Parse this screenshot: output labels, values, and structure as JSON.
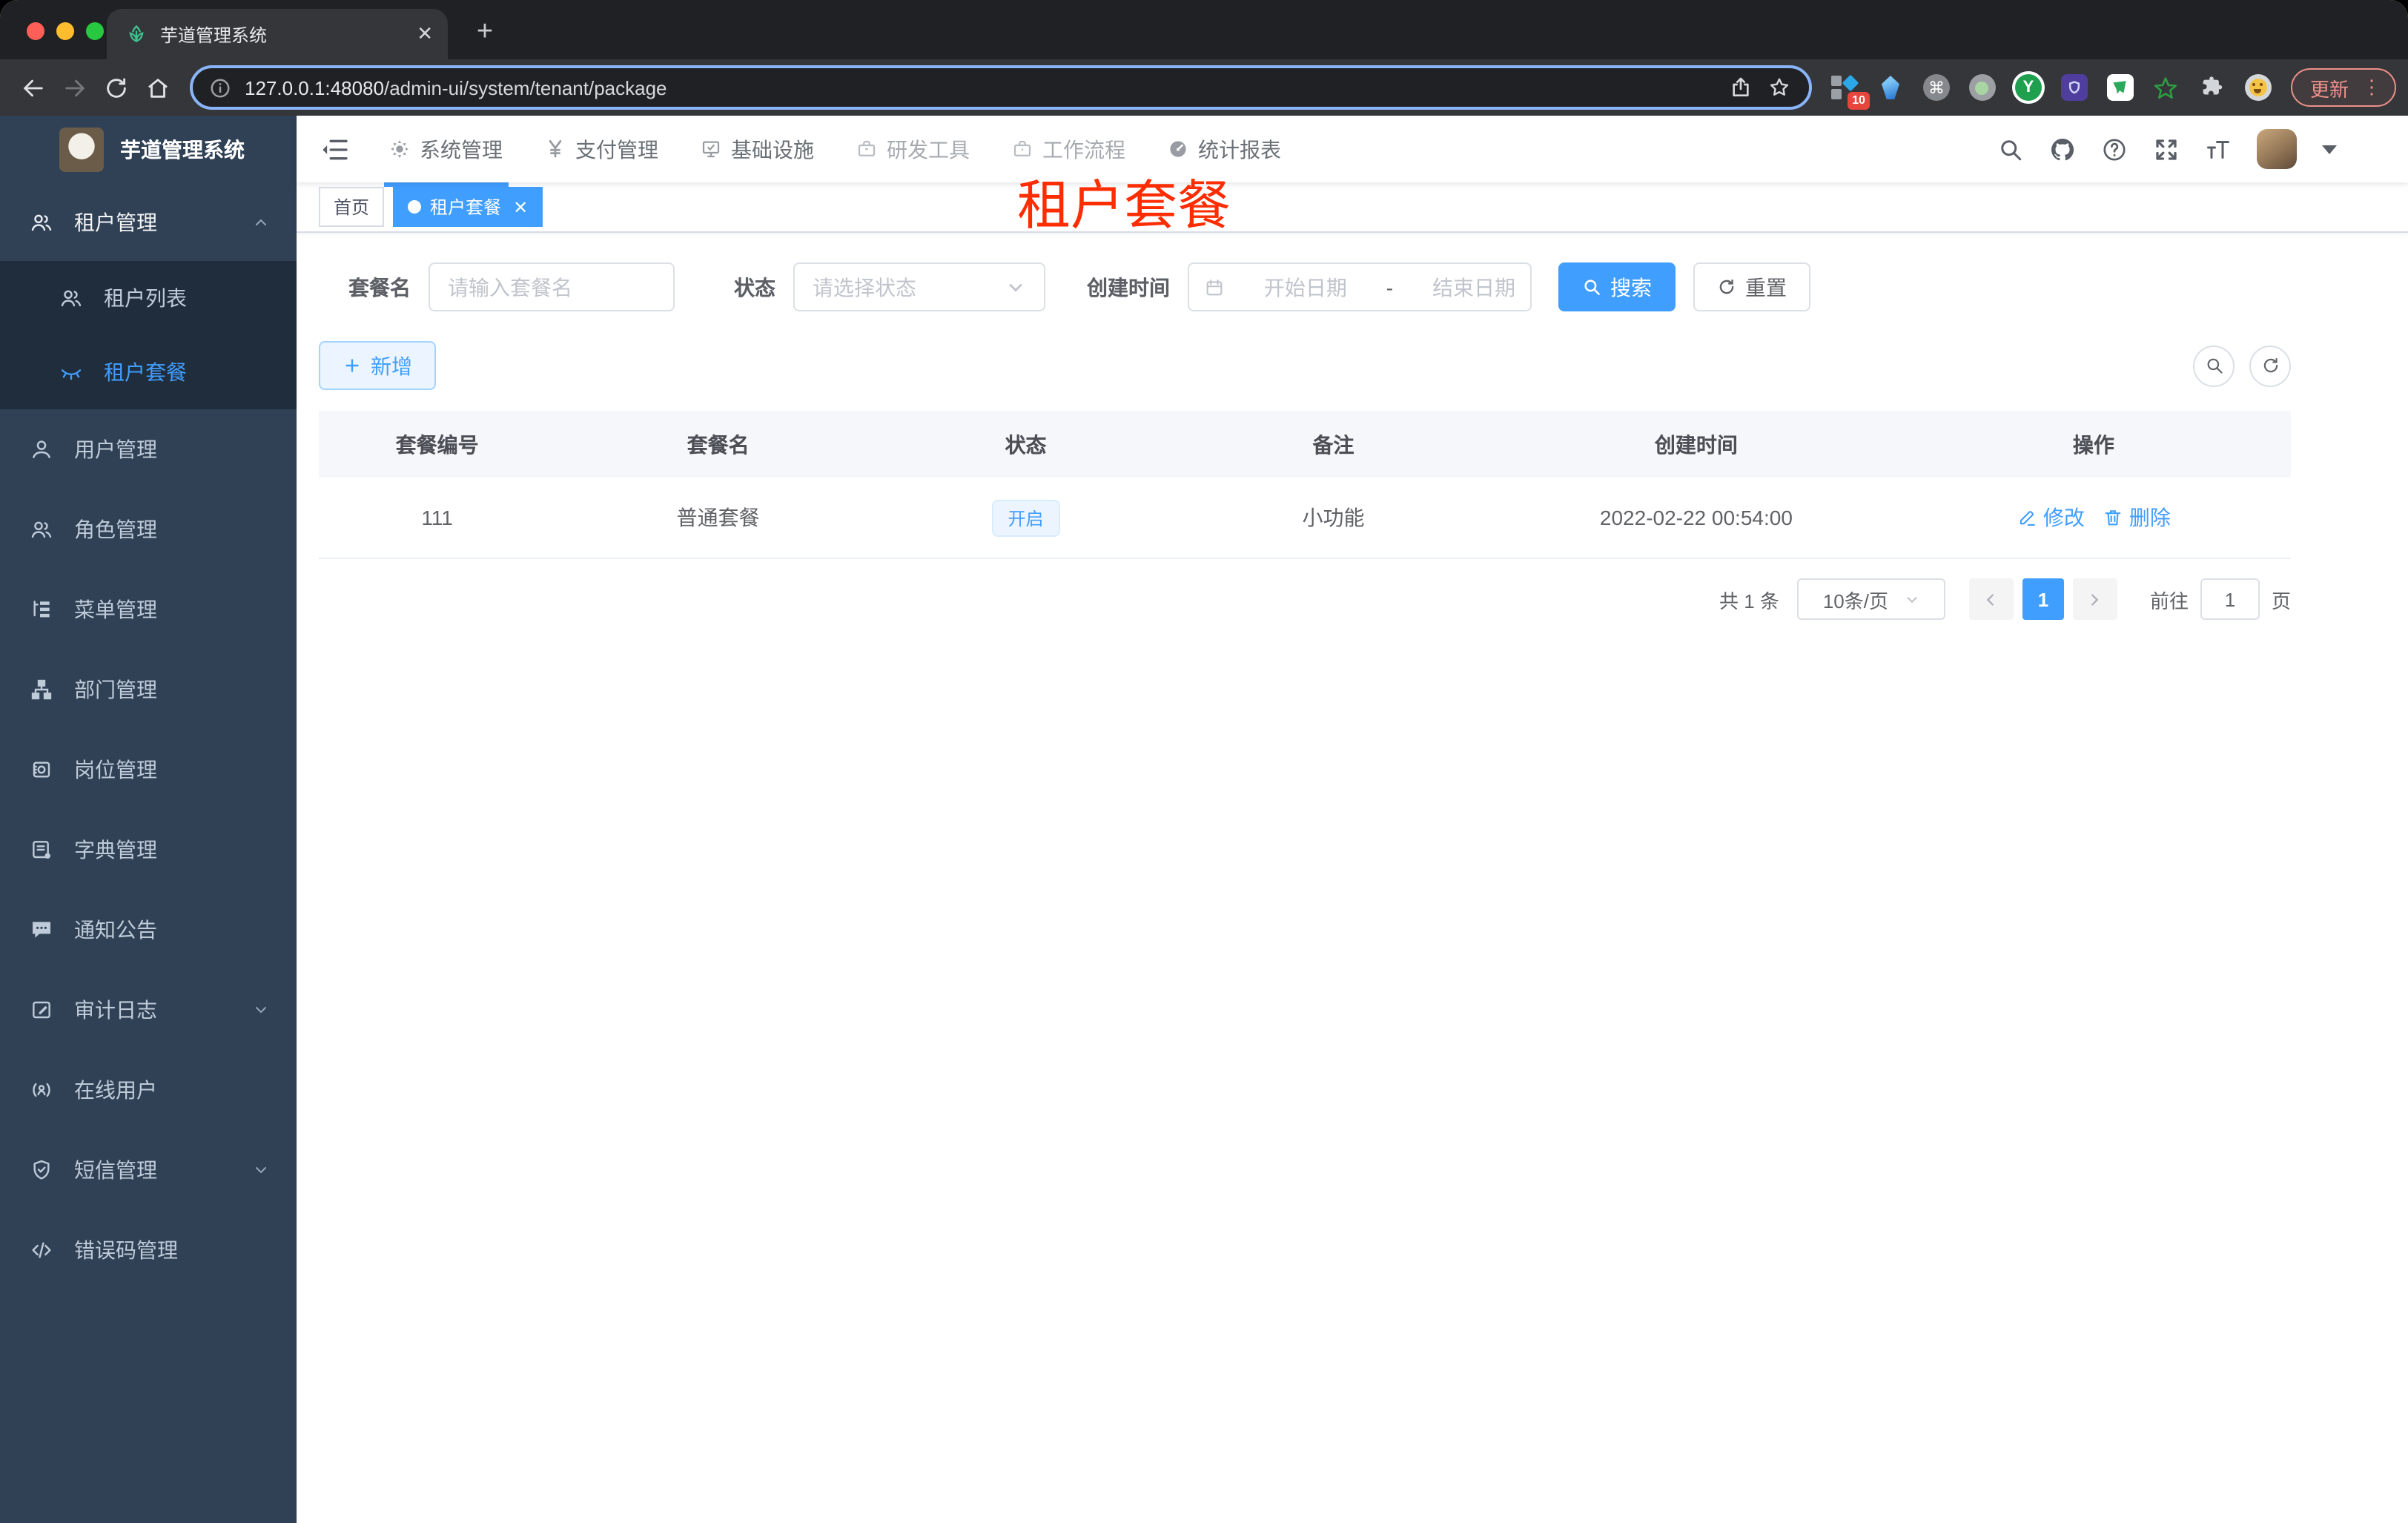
{
  "browser": {
    "tab": {
      "title": "芋道管理系统",
      "favicon_icon": "plant-favicon-icon"
    },
    "toolbar": {
      "url_host": "127.0.0.1:48080",
      "url_path": "/admin-ui/system/tenant/package",
      "extension_badge": "10",
      "update_label": "更新",
      "extension_icons": [
        "grid-diamond-icon",
        "gem-icon",
        "command-icon",
        "green-dot-icon",
        "y-circle-icon",
        "shield-purple-icon",
        "chat-green-icon",
        "star-green-icon",
        "puzzle-icon",
        "profile-face-icon"
      ]
    }
  },
  "sidebar": {
    "title": "芋道管理系统",
    "logo_icon": "rabbit-logo",
    "items": [
      {
        "label": "租户管理",
        "icon": "peoples-icon",
        "caret": "up"
      },
      {
        "label": "租户列表",
        "icon": "peoples-icon"
      },
      {
        "label": "租户套餐",
        "icon": "eye-closed-icon",
        "active": true
      },
      {
        "label": "用户管理",
        "icon": "user-icon"
      },
      {
        "label": "角色管理",
        "icon": "peoples-icon"
      },
      {
        "label": "菜单管理",
        "icon": "tree-table-icon"
      },
      {
        "label": "部门管理",
        "icon": "tree-icon"
      },
      {
        "label": "岗位管理",
        "icon": "post-icon"
      },
      {
        "label": "字典管理",
        "icon": "dict-icon"
      },
      {
        "label": "通知公告",
        "icon": "message-icon"
      },
      {
        "label": "审计日志",
        "icon": "log-icon",
        "caret": "down"
      },
      {
        "label": "在线用户",
        "icon": "online-icon"
      },
      {
        "label": "短信管理",
        "icon": "sms-shield-icon",
        "caret": "down"
      },
      {
        "label": "错误码管理",
        "icon": "code-icon"
      }
    ]
  },
  "navbar": {
    "menus": [
      {
        "label": "系统管理",
        "icon": "gear-icon"
      },
      {
        "label": "支付管理",
        "icon": "yen-icon"
      },
      {
        "label": "基础设施",
        "icon": "monitor-icon"
      },
      {
        "label": "研发工具",
        "icon": "toolbox-icon"
      },
      {
        "label": "工作流程",
        "icon": "workflow-icon"
      },
      {
        "label": "统计报表",
        "icon": "dashboard-icon"
      }
    ],
    "right_icons": [
      "search-icon",
      "github-icon",
      "help-icon",
      "fullscreen-icon",
      "font-size-icon"
    ]
  },
  "tags": {
    "home": "首页",
    "active": "租户套餐"
  },
  "annotation": "租户套餐",
  "filter": {
    "name_label": "套餐名",
    "name_placeholder": "请输入套餐名",
    "status_label": "状态",
    "status_placeholder": "请选择状态",
    "date_label": "创建时间",
    "date_start_placeholder": "开始日期",
    "date_separator": "-",
    "date_end_placeholder": "结束日期",
    "search_label": "搜索",
    "reset_label": "重置"
  },
  "actions": {
    "add_label": "新增"
  },
  "table": {
    "headers": [
      "套餐编号",
      "套餐名",
      "状态",
      "备注",
      "创建时间",
      "操作"
    ],
    "rows": [
      {
        "id": "111",
        "name": "普通套餐",
        "status": "开启",
        "remark": "小功能",
        "created_at": "2022-02-22 00:54:00",
        "edit_label": "修改",
        "delete_label": "删除"
      }
    ]
  },
  "pagination": {
    "total": "共 1 条",
    "page_size": "10条/页",
    "current_page": "1",
    "goto_label": "前往",
    "goto_value": "1",
    "page_unit": "页"
  },
  "colors": {
    "accent": "#409eff",
    "sidebar_bg": "#304156",
    "submenu_bg": "#1f2d3d",
    "tag_active_bg": "#409eff",
    "annotation_red": "#fe2c01",
    "status_tag_bg": "#ecf5ff"
  }
}
